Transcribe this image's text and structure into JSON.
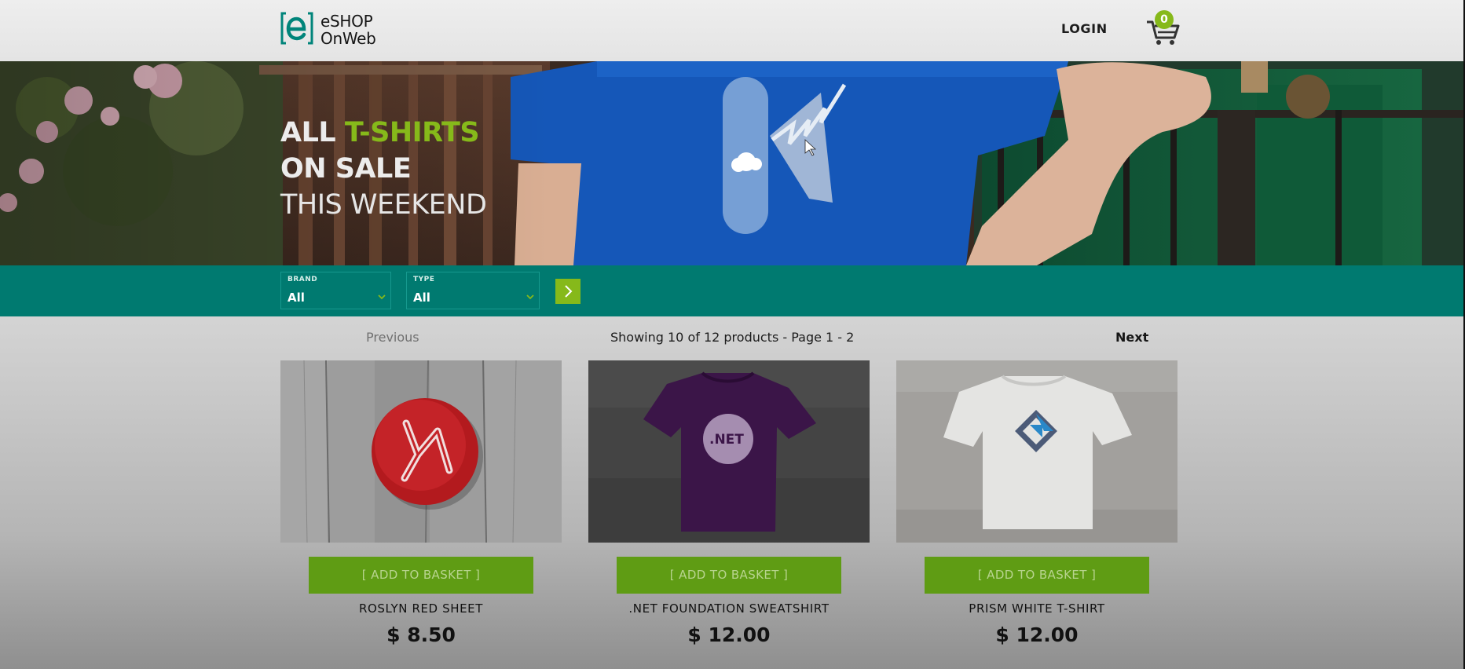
{
  "header": {
    "logo_line1": "eSHOP",
    "logo_line2": "OnWeb",
    "login_label": "LOGIN",
    "cart_count": "0"
  },
  "hero": {
    "line1_prefix": "ALL ",
    "line1_accent": "T-SHIRTS",
    "line2": "ON SALE",
    "line3": "THIS WEEKEND"
  },
  "filters": {
    "brand": {
      "label": "BRAND",
      "value": "All"
    },
    "type": {
      "label": "TYPE",
      "value": "All"
    }
  },
  "pager": {
    "previous": "Previous",
    "info": "Showing 10 of 12 products - Page 1 - 2",
    "next": "Next"
  },
  "products": [
    {
      "name": "ROSLYN RED SHEET",
      "price": "$ 8.50",
      "add_label": "[ ADD TO BASKET ]",
      "image": "roslyn-red-pin"
    },
    {
      "name": ".NET FOUNDATION SWEATSHIRT",
      "price": "$ 12.00",
      "add_label": "[ ADD TO BASKET ]",
      "image": "purple-net-shirt"
    },
    {
      "name": "PRISM WHITE T-SHIRT",
      "price": "$ 12.00",
      "add_label": "[ ADD TO BASKET ]",
      "image": "white-prism-shirt"
    }
  ],
  "colors": {
    "brand_green": "#86b91a",
    "teal_bar": "#007a70",
    "button_green": "#5f9c14"
  }
}
